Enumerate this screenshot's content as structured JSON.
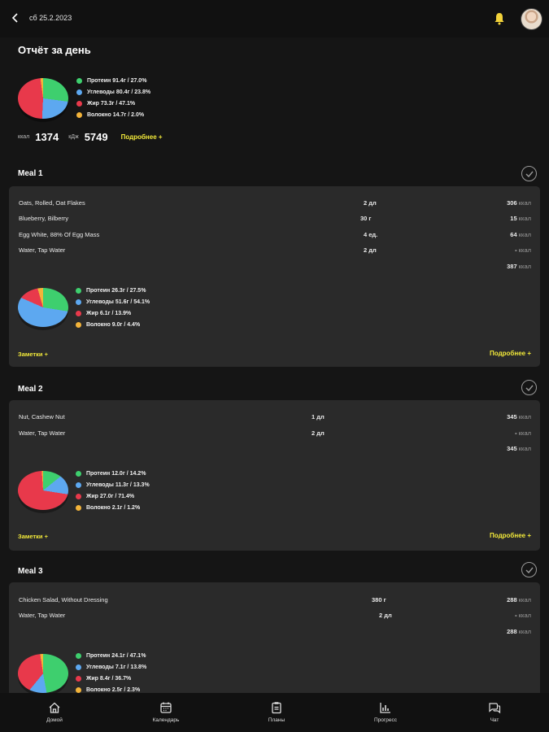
{
  "header": {
    "date": "сб 25.2.2023"
  },
  "report": {
    "title": "Отчёт за день",
    "legend": [
      {
        "label": "Протеин 91.4г / 27.0%",
        "color": "#3ecf6e"
      },
      {
        "label": "Углеводы 80.4г / 23.8%",
        "color": "#5da8f0"
      },
      {
        "label": "Жир 73.3г / 47.1%",
        "color": "#e8394b"
      },
      {
        "label": "Волокно 14.7г / 2.0%",
        "color": "#f2b33a"
      }
    ],
    "pie_fractions": [
      0.27,
      0.238,
      0.471,
      0.02
    ],
    "kcal_label": "ккал",
    "kcal_value": "1374",
    "kj_label": "кДж",
    "kj_value": "5749",
    "more": "Подробнее +"
  },
  "meals": [
    {
      "title": "Meal 1",
      "items": [
        {
          "name": "Oats, Rolled, Oat Flakes",
          "qty": "2 дл",
          "kcal": "306",
          "unit": "ккал"
        },
        {
          "name": "Blueberry, Bilberry",
          "qty": "30 г",
          "kcal": "15",
          "unit": "ккал"
        },
        {
          "name": "Egg White, 88% Of Egg Mass",
          "qty": "4 ед.",
          "kcal": "64",
          "unit": "ккал"
        },
        {
          "name": "Water, Tap Water",
          "qty": "2 дл",
          "kcal": "-",
          "unit": "ккал"
        }
      ],
      "total": "387",
      "total_unit": "ккал",
      "legend": [
        {
          "label": "Протеин 26.3г / 27.5%",
          "color": "#3ecf6e"
        },
        {
          "label": "Углеводы 51.6г / 54.1%",
          "color": "#5da8f0"
        },
        {
          "label": "Жир 6.1г / 13.9%",
          "color": "#e8394b"
        },
        {
          "label": "Волокно 9.0г / 4.4%",
          "color": "#f2b33a"
        }
      ],
      "pie_fractions": [
        0.275,
        0.541,
        0.139,
        0.044
      ],
      "notes": "Заметки +",
      "more": "Подробнее +"
    },
    {
      "title": "Meal 2",
      "items": [
        {
          "name": "Nut, Cashew Nut",
          "qty": "1 дл",
          "kcal": "345",
          "unit": "ккал"
        },
        {
          "name": "Water, Tap Water",
          "qty": "2 дл",
          "kcal": "-",
          "unit": "ккал"
        }
      ],
      "total": "345",
      "total_unit": "ккал",
      "legend": [
        {
          "label": "Протеин 12.0г / 14.2%",
          "color": "#3ecf6e"
        },
        {
          "label": "Углеводы 11.3г / 13.3%",
          "color": "#5da8f0"
        },
        {
          "label": "Жир 27.0г / 71.4%",
          "color": "#e8394b"
        },
        {
          "label": "Волокно 2.1г / 1.2%",
          "color": "#f2b33a"
        }
      ],
      "pie_fractions": [
        0.142,
        0.133,
        0.714,
        0.012
      ],
      "notes": "Заметки +",
      "more": "Подробнее +"
    },
    {
      "title": "Meal 3",
      "items": [
        {
          "name": "Chicken Salad, Without Dressing",
          "qty": "380 г",
          "kcal": "288",
          "unit": "ккал"
        },
        {
          "name": "Water, Tap Water",
          "qty": "2 дл",
          "kcal": "-",
          "unit": "ккал"
        }
      ],
      "total": "288",
      "total_unit": "ккал",
      "legend": [
        {
          "label": "Протеин 24.1г / 47.1%",
          "color": "#3ecf6e"
        },
        {
          "label": "Углеводы 7.1г / 13.8%",
          "color": "#5da8f0"
        },
        {
          "label": "Жир 8.4г / 36.7%",
          "color": "#e8394b"
        },
        {
          "label": "Волокно 2.5г / 2.3%",
          "color": "#f2b33a"
        }
      ],
      "pie_fractions": [
        0.471,
        0.138,
        0.367,
        0.023
      ]
    }
  ],
  "nav": [
    {
      "label": "Домой",
      "icon": "home-icon"
    },
    {
      "label": "Календарь",
      "icon": "calendar-icon"
    },
    {
      "label": "Планы",
      "icon": "clipboard-icon"
    },
    {
      "label": "Прогресс",
      "icon": "bar-chart-icon"
    },
    {
      "label": "Чат",
      "icon": "chat-icon"
    }
  ]
}
